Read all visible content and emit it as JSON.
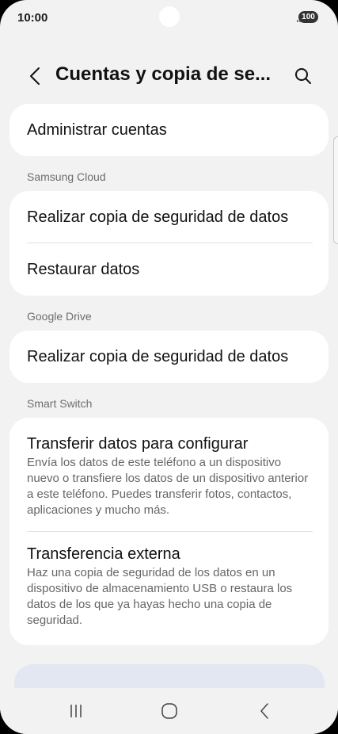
{
  "status_bar": {
    "time": "10:00",
    "battery": "100",
    "icons": [
      "signal-icon",
      "battery-icon"
    ]
  },
  "header": {
    "title": "Cuentas y copia de se...",
    "back_icon": "back-arrow-icon",
    "search_icon": "search-icon"
  },
  "account": {
    "manage_label": "Administrar cuentas"
  },
  "samsung_cloud": {
    "header": "Samsung Cloud",
    "items": [
      {
        "label": "Realizar copia de seguridad de datos"
      },
      {
        "label": "Restaurar datos"
      }
    ]
  },
  "google_drive": {
    "header": "Google Drive",
    "items": [
      {
        "label": "Realizar copia de seguridad de datos"
      }
    ]
  },
  "smart_switch": {
    "header": "Smart Switch",
    "items": [
      {
        "label": "Transferir datos para configurar",
        "description": "Envía los datos de este teléfono a un dispositivo nuevo o transfiere los datos de un dispositivo anterior a este teléfono. Puedes transferir fotos, contactos, aplicaciones y mucho más."
      },
      {
        "label": "Transferencia externa",
        "description": "Haz una copia de seguridad de los datos en un dispositivo de almacenamiento USB o restaura los datos de los que ya hayas hecho una copia de seguridad."
      }
    ]
  },
  "nav_bar": {
    "icons": [
      "recent-apps-icon",
      "home-icon",
      "back-icon"
    ]
  },
  "colors": {
    "background": "#f2f2f2",
    "card": "#ffffff",
    "peek_card": "#e3e7f2",
    "secondary_text": "#666666"
  }
}
